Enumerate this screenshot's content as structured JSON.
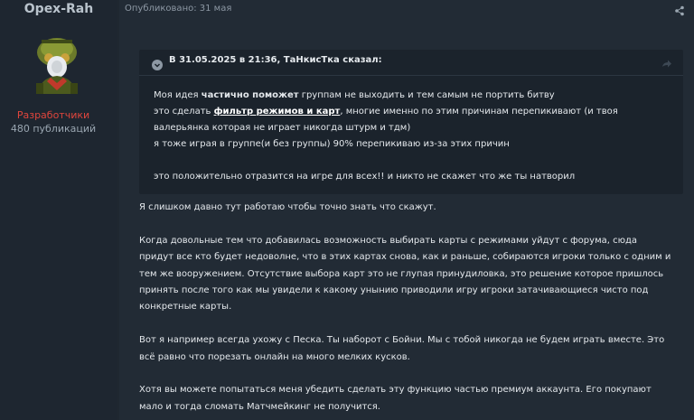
{
  "author": {
    "name": "Opex-Rah",
    "role": "Разработчики",
    "post_count": "480 публикаций"
  },
  "post": {
    "meta": "Опубликовано: 31 мая",
    "quote": {
      "header": "В 31.05.2025 в 21:36, ТаНкисТка сказал:",
      "line1_part1": "Моя идея ",
      "line1_bold": "частично поможет",
      "line1_part2": " группам не выходить и тем самым не портить битву",
      "line2_part1": "это сделать ",
      "line2_link": "фильтр режимов и карт",
      "line2_part2": ", многие именно по этим причинам перепикивают (и твоя",
      "line3": "валерьянка которая не играет никогда штурм и тдм)",
      "line4": "я тоже играя в группе(и без группы) 90% перепикиваю из-за этих причин",
      "line5": "это положительно отразится на игре для всех!! и никто не скажет что же ты натворил"
    },
    "paragraphs": {
      "p1": "Я слишком давно тут работаю чтобы точно знать что скажут.",
      "p2_l1": "Когда довольные тем что добавилась возможность выбирать карты с режимами уйдут с форума, сюда",
      "p2_l2": "придут все кто будет недоволне, что в этих картах снова, как и раньше, собираются игроки только с одним и",
      "p2_l3": "тем же вооружением. Отсутствие выбора карт это не глупая принудиловка, это решение которое пришлось",
      "p2_l4": "принять после того как мы увидели к какому унынию приводили игру игроки затачивающиеся чисто под",
      "p2_l5": "конкретные карты.",
      "p3_l1": "Вот я например всегда ухожу с Песка. Ты наборот с Бойни. Мы с тобой никогда не будем играть вместе. Это",
      "p3_l2": "всё равно что порезать онлайн на много мелких кусков.",
      "p4_l1": "Хотя вы можете попытаться меня убедить сделать эту функцию частью премиум аккаунта. Его покупают",
      "p4_l2": "мало и тогда сломать Матчмейкинг не получится."
    }
  },
  "icons": {
    "share": "share-icon",
    "quote_toggle": "chevron-down-icon",
    "quote_link": "reply-arrow-icon",
    "avatar": "soldier-avatar"
  },
  "colors": {
    "background": "#1f2730",
    "quote_background": "#1b232c",
    "role_color": "#e0453c"
  }
}
